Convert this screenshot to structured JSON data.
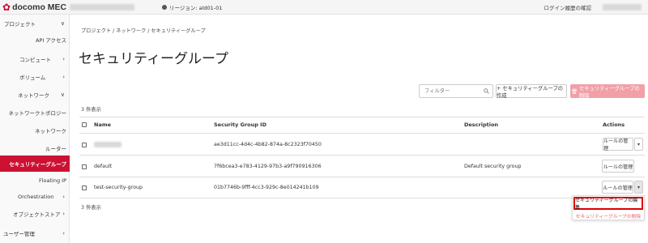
{
  "header": {
    "logo_text": "docomo MEC",
    "region_label": "リージョン: ald01-01",
    "login_history": "ログイン履歴の確認"
  },
  "sidebar": {
    "items": [
      {
        "label": "プロジェクト",
        "chevron": "∨"
      },
      {
        "label": "API アクセス",
        "chevron": ""
      },
      {
        "label": "コンピュート",
        "chevron": "›"
      },
      {
        "label": "ボリューム",
        "chevron": "›"
      },
      {
        "label": "ネットワーク",
        "chevron": "∨"
      },
      {
        "label": "ネットワークトポロジー",
        "chevron": ""
      },
      {
        "label": "ネットワーク",
        "chevron": ""
      },
      {
        "label": "ルーター",
        "chevron": ""
      },
      {
        "label": "セキュリティーグループ",
        "chevron": ""
      },
      {
        "label": "Floating IP",
        "chevron": ""
      },
      {
        "label": "Orchestration",
        "chevron": "›"
      },
      {
        "label": "オブジェクトストア",
        "chevron": "›"
      },
      {
        "label": "ユーザー管理",
        "chevron": "›"
      }
    ]
  },
  "breadcrumb": "プロジェクト / ネットワーク / セキュリティーグループ",
  "page_title": "セキュリティーグループ",
  "toolbar": {
    "filter_placeholder": "フィルター",
    "create_label": "+ セキュリティーグループの作成",
    "delete_label": "セキュリティーグループの削除"
  },
  "count_top": "3 件表示",
  "count_bottom": "3 件表示",
  "table": {
    "headers": [
      "Name",
      "Security Group ID",
      "Description",
      "Actions"
    ],
    "rows": [
      {
        "name": "",
        "id": "ae3d11cc-4d4c-4b82-874a-8c2323f70450",
        "description": "",
        "action": "ルールの管理",
        "has_caret": true
      },
      {
        "name": "default",
        "id": "7f6bcea3-e783-4129-97b3-a9f790916306",
        "description": "Default security group",
        "action": "ルールの管理",
        "has_caret": false
      },
      {
        "name": "test-security-group",
        "id": "01b7746b-9fff-4cc3-929c-8e014241b109",
        "description": "",
        "action": "ルールの管理",
        "has_caret": true
      }
    ]
  },
  "dropdown": {
    "edit_label": "セキュリティーグループの編集",
    "delete_label": "セキュリティーグループの削除"
  },
  "colors": {
    "accent": "#cc1133",
    "delete_button": "#f2a0a8",
    "highlight_box": "#dd0000"
  }
}
